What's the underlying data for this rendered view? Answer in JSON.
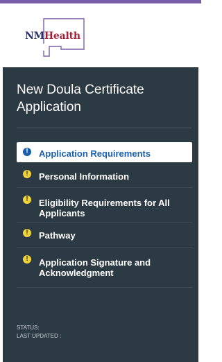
{
  "header": {
    "logo": {
      "name_part1": "NM",
      "name_part2": "Health",
      "color_part1": "#2a2f6e",
      "color_part2": "#a4233a",
      "icon": "new-mexico-state-outline-icon"
    }
  },
  "sidebar": {
    "title": "New Doula Certificate Application",
    "items": [
      {
        "label": "Application Requirements",
        "icon": "info-icon",
        "state": "current"
      },
      {
        "label": "Personal Information",
        "icon": "warning-icon",
        "state": "incomplete"
      },
      {
        "label": "Eligibility Requirements for All Applicants",
        "icon": "warning-icon",
        "state": "incomplete"
      },
      {
        "label": "Pathway",
        "icon": "warning-icon",
        "state": "incomplete"
      },
      {
        "label": "Application Signature and Acknowledgment",
        "icon": "warning-icon",
        "state": "incomplete"
      }
    ],
    "status_label": "STATUS:",
    "last_updated_label": "LAST UPDATED :"
  },
  "colors": {
    "accent_bar": "#7a5ea7",
    "sidebar_bg": "#2c3a44",
    "active_text": "#1b5fae",
    "warning_icon": "#f0d23a"
  }
}
